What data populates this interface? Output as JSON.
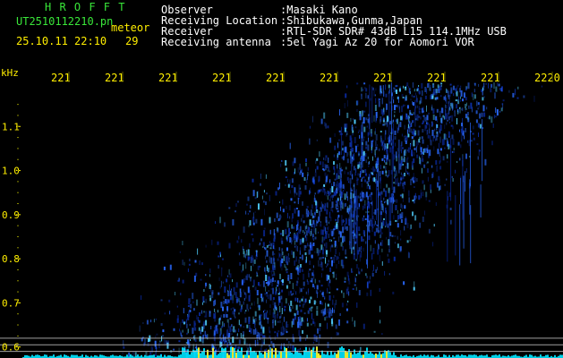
{
  "header": {
    "title": "H R O F F T",
    "filename": "UT2510112210.pn",
    "tag": "meteor",
    "datetime": "25.10.11 22:10",
    "count": "29",
    "info_labels": [
      "Observer",
      "Receiving Location",
      "Receiver",
      "Receiving antenna"
    ],
    "info_values": [
      ":Masaki Kano",
      ":Shibukawa,Gunma,Japan",
      ":RTL-SDR SDR# 43dB L15 114.1MHz USB",
      ":5el Yagi Az 20 for Aomori VOR"
    ]
  },
  "chart_data": {
    "type": "heatmap",
    "title": "",
    "ylabel": "kHz",
    "y_ticks": [
      "1.1",
      "1.0",
      "0.9",
      "0.8",
      "0.7",
      "0.6"
    ],
    "y_values": [
      1.1,
      1.0,
      0.9,
      0.8,
      0.7,
      0.6
    ],
    "ylim": [
      0.575,
      1.2
    ],
    "x_ticks": [
      "221",
      "221",
      "221",
      "221",
      "221",
      "221",
      "221",
      "221",
      "221",
      "2220"
    ],
    "grid_lines_khz": [
      0.62,
      0.605,
      0.59
    ],
    "colors": {
      "background": "#000000",
      "low": "#0a2aa0",
      "mid": "#2a6aff",
      "high": "#50d0ff",
      "baseline": "#00e5ff",
      "hot": "#ffff30",
      "axis_text": "#ffee00",
      "grid": "#c8c8c8"
    }
  }
}
